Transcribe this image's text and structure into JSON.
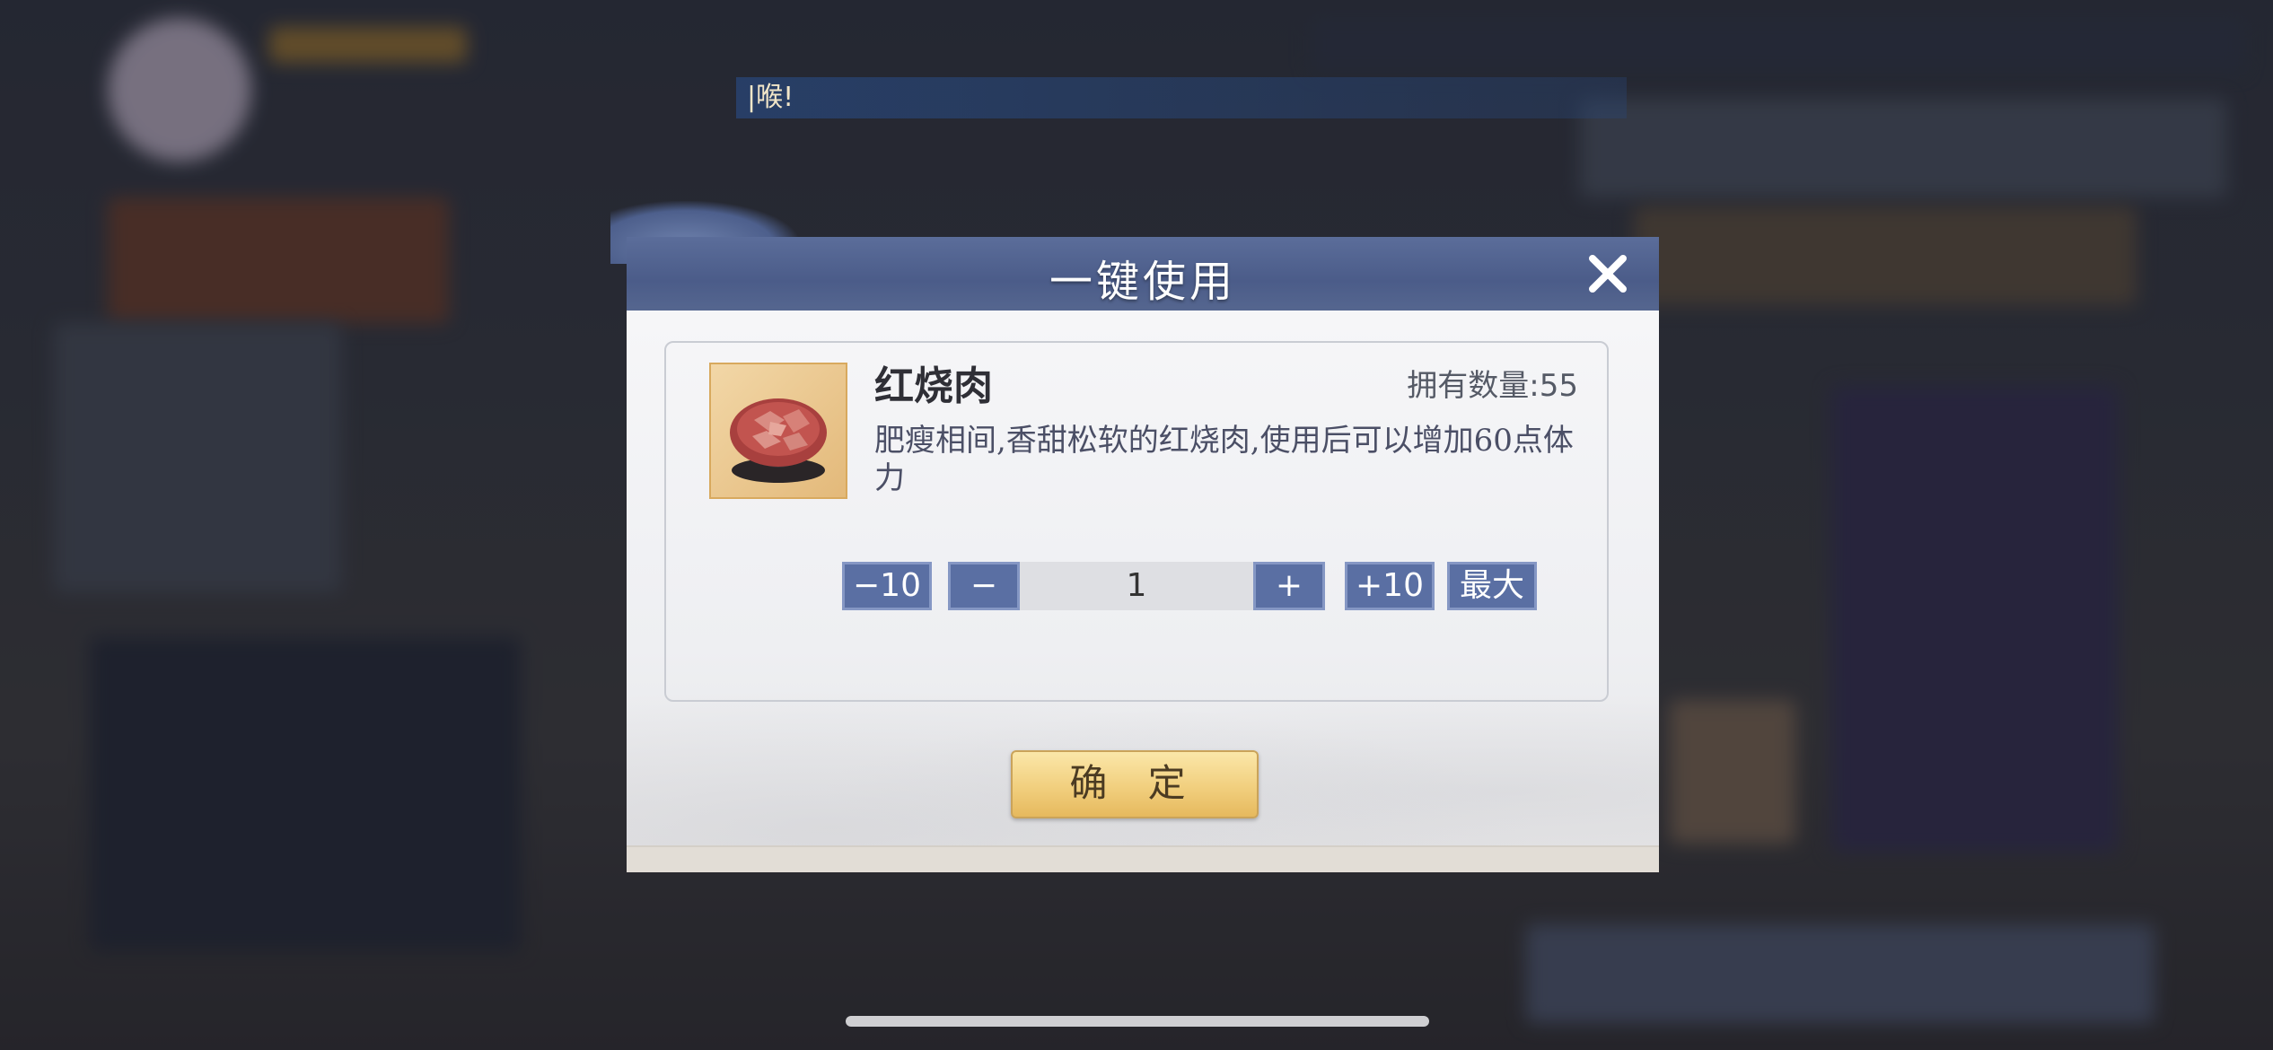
{
  "background": {
    "ticker_text": "|喉!"
  },
  "dialog": {
    "title": "一键使用",
    "close_icon": "close-icon",
    "item": {
      "name": "红烧肉",
      "owned_label": "拥有数量:55",
      "description": "肥瘦相间,香甜松软的红烧肉,使用后可以增加60点体力",
      "icon": "braised-pork-bowl-icon"
    },
    "quantity": {
      "minus10_label": "−10",
      "minus_label": "−",
      "value": "1",
      "plus_label": "+",
      "plus10_label": "+10",
      "max_label": "最大"
    },
    "confirm_label": "确 定"
  },
  "colors": {
    "header": "#4b5c89",
    "button_blue": "#5a6fa3",
    "confirm_gold": "#f1cf7e"
  }
}
